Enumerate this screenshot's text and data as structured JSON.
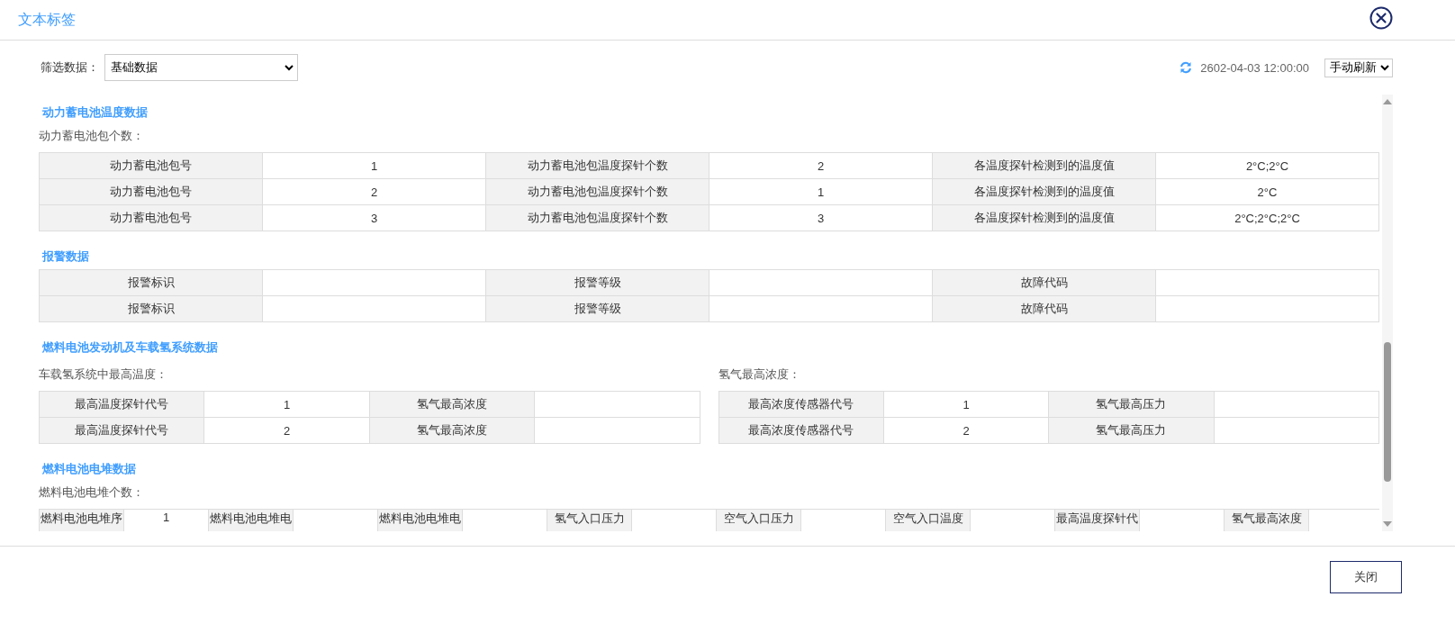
{
  "dialog": {
    "title": "文本标签",
    "close_button": "关闭"
  },
  "filter": {
    "label": "筛选数据：",
    "value": "基础数据"
  },
  "refresh": {
    "time": "2602-04-03 12:00:00",
    "mode": "手动刷新"
  },
  "sections": [
    {
      "kind": "grid",
      "title": "动力蓄电池温度数据",
      "subtitle": "动力蓄电池包个数：",
      "rows": [
        [
          "动力蓄电池包号",
          "1",
          "动力蓄电池包温度探针个数",
          "2",
          "各温度探针检测到的温度值",
          "2°C;2°C"
        ],
        [
          "动力蓄电池包号",
          "2",
          "动力蓄电池包温度探针个数",
          "1",
          "各温度探针检测到的温度值",
          "2°C"
        ],
        [
          "动力蓄电池包号",
          "3",
          "动力蓄电池包温度探针个数",
          "3",
          "各温度探针检测到的温度值",
          "2°C;2°C;2°C"
        ]
      ]
    },
    {
      "kind": "grid",
      "title": "报警数据",
      "rows": [
        [
          "报警标识",
          null,
          "报警等级",
          null,
          "故障代码",
          null
        ],
        [
          "报警标识",
          null,
          "报警等级",
          null,
          "故障代码",
          null
        ]
      ]
    },
    {
      "kind": "split",
      "title": "燃料电池发动机及车载氢系统数据",
      "panels": [
        {
          "subtitle": "车载氢系统中最高温度：",
          "rows": [
            [
              "最高温度探针代号",
              "1",
              "氢气最高浓度",
              null
            ],
            [
              "最高温度探针代号",
              "2",
              "氢气最高浓度",
              null
            ]
          ]
        },
        {
          "subtitle": "氢气最高浓度：",
          "rows": [
            [
              "最高浓度传感器代号",
              "1",
              "氢气最高压力",
              null
            ],
            [
              "最高浓度传感器代号",
              "2",
              "氢气最高压力",
              null
            ]
          ]
        }
      ]
    },
    {
      "kind": "wide",
      "title": "燃料电池电堆数据",
      "subtitle": "燃料电池电堆个数：",
      "rows": [
        [
          "燃料电池电堆序",
          "1",
          "燃料电池电堆电",
          null,
          "燃料电池电堆电",
          null,
          "氢气入口压力",
          null,
          "空气入口压力",
          null,
          "空气入口温度",
          null,
          "最高温度探针代",
          null,
          "氢气最高浓度",
          null
        ]
      ]
    }
  ]
}
